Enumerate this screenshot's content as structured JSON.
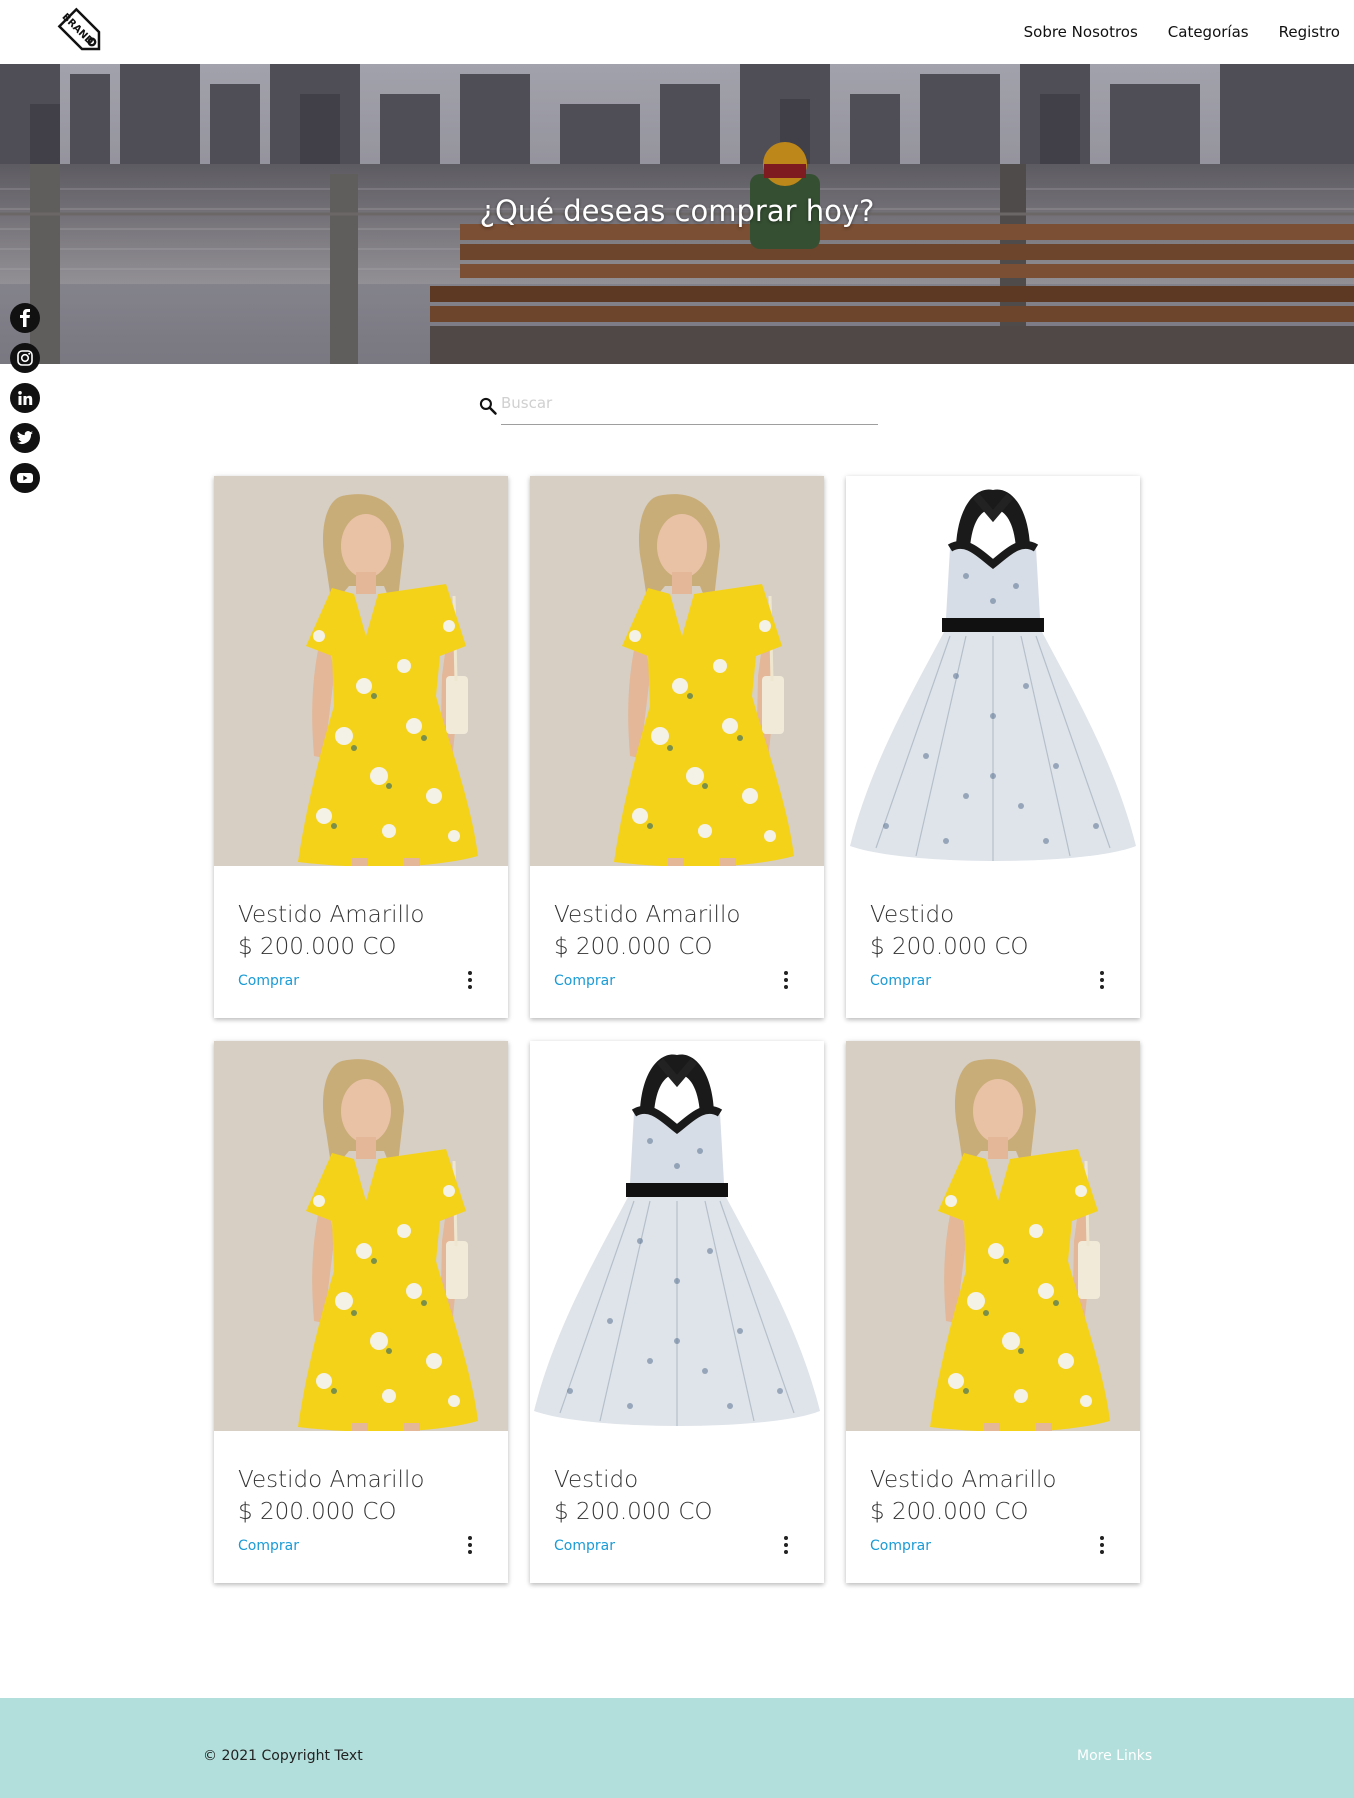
{
  "header": {
    "logo_text": "BRAND",
    "nav": [
      "Sobre Nosotros",
      "Categorías",
      "Registro"
    ]
  },
  "hero": {
    "title": "¿Qué deseas comprar hoy?"
  },
  "social": [
    "facebook-icon",
    "instagram-icon",
    "linkedin-icon",
    "twitter-icon",
    "youtube-icon"
  ],
  "search": {
    "placeholder": "Buscar"
  },
  "products": [
    {
      "name": "Vestido Amarillo",
      "price": "$ 200.000 CO",
      "action": "Comprar",
      "image": "yellow-dress"
    },
    {
      "name": "Vestido Amarillo",
      "price": "$ 200.000 CO",
      "action": "Comprar",
      "image": "yellow-dress"
    },
    {
      "name": "Vestido",
      "price": "$ 200.000 CO",
      "action": "Comprar",
      "image": "floral-dress"
    },
    {
      "name": "Vestido Amarillo",
      "price": "$ 200.000 CO",
      "action": "Comprar",
      "image": "yellow-dress"
    },
    {
      "name": "Vestido",
      "price": "$ 200.000 CO",
      "action": "Comprar",
      "image": "floral-dress"
    },
    {
      "name": "Vestido Amarillo",
      "price": "$ 200.000 CO",
      "action": "Comprar",
      "image": "yellow-dress"
    }
  ],
  "footer": {
    "copyright": "© 2021 Copyright Text",
    "links": "More Links"
  },
  "colors": {
    "accent": "#1a9bd6",
    "footer_bg": "#b2dfdb"
  }
}
